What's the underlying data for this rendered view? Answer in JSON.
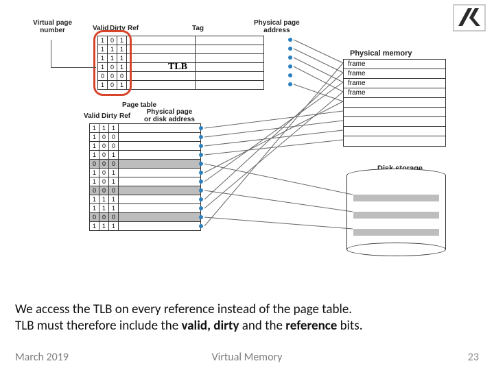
{
  "labels": {
    "vpn": "Virtual page\nnumber",
    "valid": "Valid",
    "dirty": "Dirty",
    "ref": "Ref",
    "tag": "Tag",
    "ppa": "Physical page\naddress",
    "page_table": "Page table",
    "ppa_disk": "Physical page\nor disk address",
    "physmem": "Physical memory",
    "disk": "Disk storage",
    "tlb": "TLB",
    "frame": "frame"
  },
  "tlb_rows": [
    {
      "v": "1",
      "d": "0",
      "r": "1"
    },
    {
      "v": "1",
      "d": "1",
      "r": "1"
    },
    {
      "v": "1",
      "d": "1",
      "r": "1"
    },
    {
      "v": "1",
      "d": "0",
      "r": "1"
    },
    {
      "v": "0",
      "d": "0",
      "r": "0"
    },
    {
      "v": "1",
      "d": "0",
      "r": "1"
    }
  ],
  "pt_rows": [
    {
      "v": "1",
      "d": "1",
      "r": "1",
      "shaded": false
    },
    {
      "v": "1",
      "d": "0",
      "r": "0",
      "shaded": false
    },
    {
      "v": "1",
      "d": "0",
      "r": "0",
      "shaded": false
    },
    {
      "v": "1",
      "d": "0",
      "r": "1",
      "shaded": false
    },
    {
      "v": "0",
      "d": "0",
      "r": "0",
      "shaded": true
    },
    {
      "v": "1",
      "d": "0",
      "r": "1",
      "shaded": false
    },
    {
      "v": "1",
      "d": "0",
      "r": "1",
      "shaded": false
    },
    {
      "v": "0",
      "d": "0",
      "r": "0",
      "shaded": true
    },
    {
      "v": "1",
      "d": "1",
      "r": "1",
      "shaded": false
    },
    {
      "v": "1",
      "d": "1",
      "r": "1",
      "shaded": false
    },
    {
      "v": "0",
      "d": "0",
      "r": "0",
      "shaded": true
    },
    {
      "v": "1",
      "d": "1",
      "r": "1",
      "shaded": false
    }
  ],
  "caption": {
    "line1_a": "We access the TLB on every reference instead of the page table.",
    "line2_a": "TLB must therefore include the ",
    "line2_b": "valid, dirty",
    "line2_c": " and the ",
    "line2_d": "reference",
    "line2_e": " bits."
  },
  "footer": {
    "left": "March 2019",
    "center": "Virtual Memory",
    "right": "23"
  }
}
